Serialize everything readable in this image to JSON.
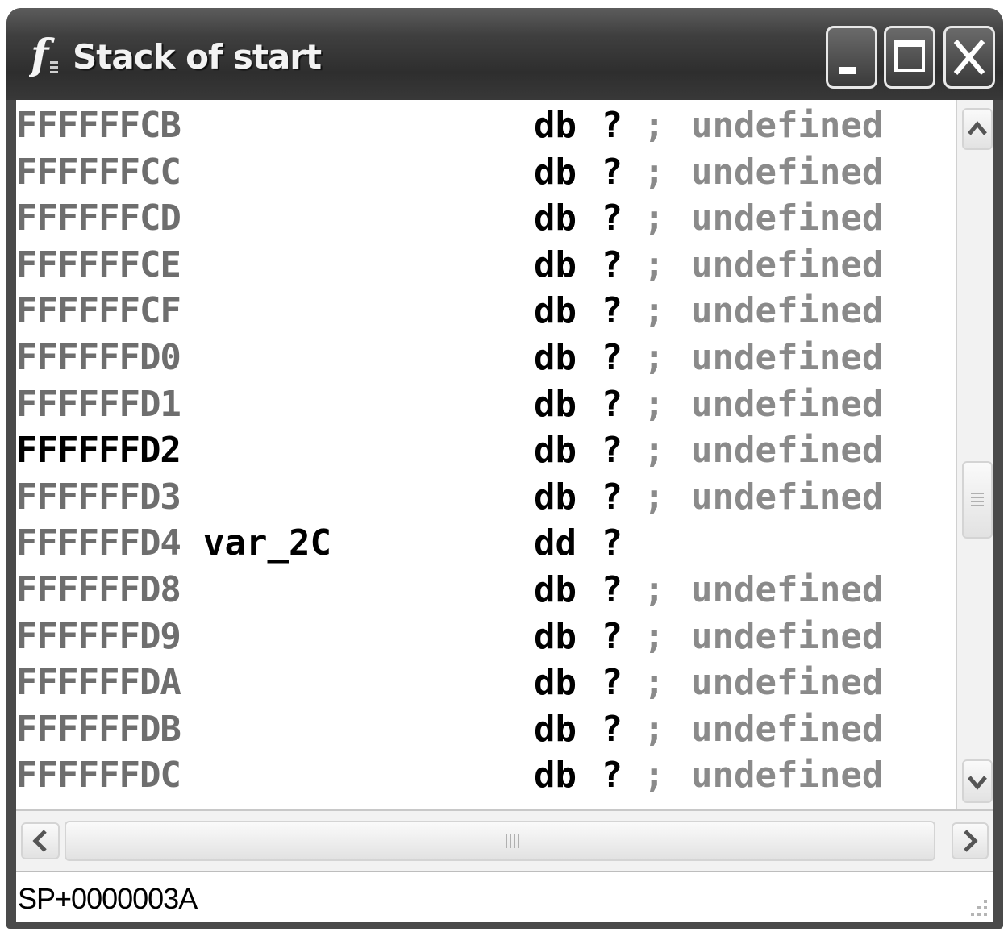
{
  "window": {
    "title": "Stack of start",
    "icon": "function-icon"
  },
  "listing": {
    "rows": [
      {
        "addr": "FFFFFFCB",
        "name": "",
        "instr": "db ?",
        "comment": "; undefined"
      },
      {
        "addr": "FFFFFFCC",
        "name": "",
        "instr": "db ?",
        "comment": "; undefined"
      },
      {
        "addr": "FFFFFFCD",
        "name": "",
        "instr": "db ?",
        "comment": "; undefined"
      },
      {
        "addr": "FFFFFFCE",
        "name": "",
        "instr": "db ?",
        "comment": "; undefined"
      },
      {
        "addr": "FFFFFFCF",
        "name": "",
        "instr": "db ?",
        "comment": "; undefined"
      },
      {
        "addr": "FFFFFFD0",
        "name": "",
        "instr": "db ?",
        "comment": "; undefined"
      },
      {
        "addr": "FFFFFFD1",
        "name": "",
        "instr": "db ?",
        "comment": "; undefined"
      },
      {
        "addr": "FFFFFFD2",
        "name": "",
        "instr": "db ?",
        "comment": "; undefined",
        "current": true
      },
      {
        "addr": "FFFFFFD3",
        "name": "",
        "instr": "db ?",
        "comment": "; undefined"
      },
      {
        "addr": "FFFFFFD4",
        "name": "var_2C",
        "instr": "dd ?",
        "comment": ""
      },
      {
        "addr": "FFFFFFD8",
        "name": "",
        "instr": "db ?",
        "comment": "; undefined"
      },
      {
        "addr": "FFFFFFD9",
        "name": "",
        "instr": "db ?",
        "comment": "; undefined"
      },
      {
        "addr": "FFFFFFDA",
        "name": "",
        "instr": "db ?",
        "comment": "; undefined"
      },
      {
        "addr": "FFFFFFDB",
        "name": "",
        "instr": "db ?",
        "comment": "; undefined"
      },
      {
        "addr": "FFFFFFDC",
        "name": "",
        "instr": "db ?",
        "comment": "; undefined"
      }
    ]
  },
  "statusbar": {
    "text": "SP+0000003A"
  },
  "colors": {
    "titlebar": "#3a3a3a",
    "address": "#6e6e6e",
    "current_address": "#000000",
    "comment": "#8a8a8a"
  }
}
